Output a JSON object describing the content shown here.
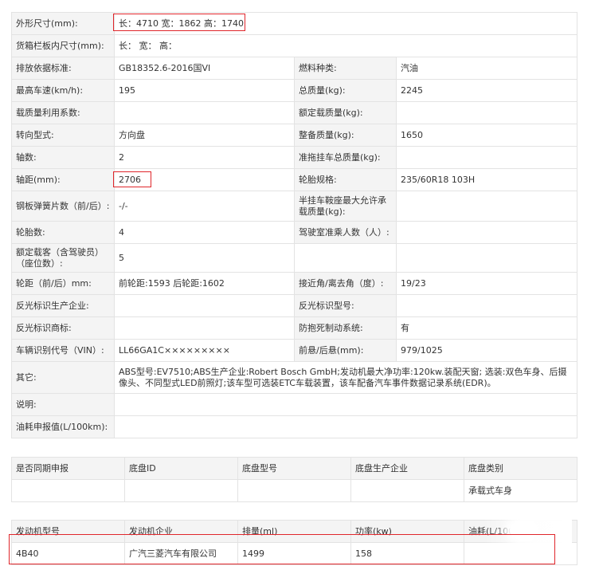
{
  "spec": {
    "rows": [
      {
        "k1": "外形尺寸(mm):",
        "v_full": "长：4710 宽：1862 高：1740"
      },
      {
        "k1": "货箱栏板内尺寸(mm):",
        "v_full": "长： 宽： 高："
      },
      {
        "k1": "排放依据标准:",
        "v1": "GB18352.6-2016国VI",
        "k2": "燃料种类:",
        "v2": "汽油"
      },
      {
        "k1": "最高车速(km/h):",
        "v1": "195",
        "k2": "总质量(kg):",
        "v2": "2245"
      },
      {
        "k1": "载质量利用系数:",
        "v1": "",
        "k2": "额定载质量(kg):",
        "v2": ""
      },
      {
        "k1": "转向型式:",
        "v1": "方向盘",
        "k2": "整备质量(kg):",
        "v2": "1650"
      },
      {
        "k1": "轴数:",
        "v1": "2",
        "k2": "准拖挂车总质量(kg):",
        "v2": ""
      },
      {
        "k1": "轴距(mm):",
        "v1": "2706",
        "k2": "轮胎规格:",
        "v2": "235/60R18 103H"
      },
      {
        "k1": "钢板弹簧片数（前/后）:",
        "v1": "-/-",
        "k2": "半挂车鞍座最大允许承载质量(kg):",
        "v2": ""
      },
      {
        "k1": "轮胎数:",
        "v1": "4",
        "k2": "驾驶室准乘人数（人）:",
        "v2": ""
      },
      {
        "k1": "额定载客（含驾驶员）（座位数）:",
        "v1": "5",
        "k2": "",
        "v2": ""
      },
      {
        "k1": "轮距（前/后）mm:",
        "v1": "前轮距:1593 后轮距:1602",
        "k2": "接近角/离去角（度）:",
        "v2": "19/23"
      },
      {
        "k1": "反光标识生产企业:",
        "v1": "",
        "k2": "反光标识型号:",
        "v2": ""
      },
      {
        "k1": "反光标识商标:",
        "v1": "",
        "k2": "防抱死制动系统:",
        "v2": "有"
      },
      {
        "k1": "车辆识别代号（VIN）:",
        "v1": "LL66GA1C×××××××××",
        "k2": "前悬/后悬(mm):",
        "v2": "979/1025"
      },
      {
        "k1": "其它:",
        "v_full": "ABS型号:EV7510;ABS生产企业:Robert Bosch GmbH;发动机最大净功率:120kw.装配天窗; 选装:双色车身、后摄像头、不同型式LED前照灯;该车型可选装ETC车载装置，该车配备汽车事件数据记录系统(EDR)。"
      },
      {
        "k1": "说明:",
        "v_full": ""
      },
      {
        "k1": "油耗申报值(L/100km):",
        "v_full": ""
      }
    ]
  },
  "chassis": {
    "headers": [
      "是否同期申报",
      "底盘ID",
      "底盘型号",
      "底盘生产企业",
      "底盘类别"
    ],
    "row": [
      "",
      "",
      "",
      "",
      "承载式车身"
    ]
  },
  "engine": {
    "headers": [
      "发动机型号",
      "发动机企业",
      "排量(ml)",
      "功率(kw)",
      "油耗(L/100"
    ],
    "row": [
      "4B40",
      "广汽三菱汽车有限公司",
      "1499",
      "158",
      ""
    ]
  },
  "colors": {
    "highlight": "#e0262b",
    "label_bg": "#f4f4f4",
    "border": "#e3e3e3"
  }
}
